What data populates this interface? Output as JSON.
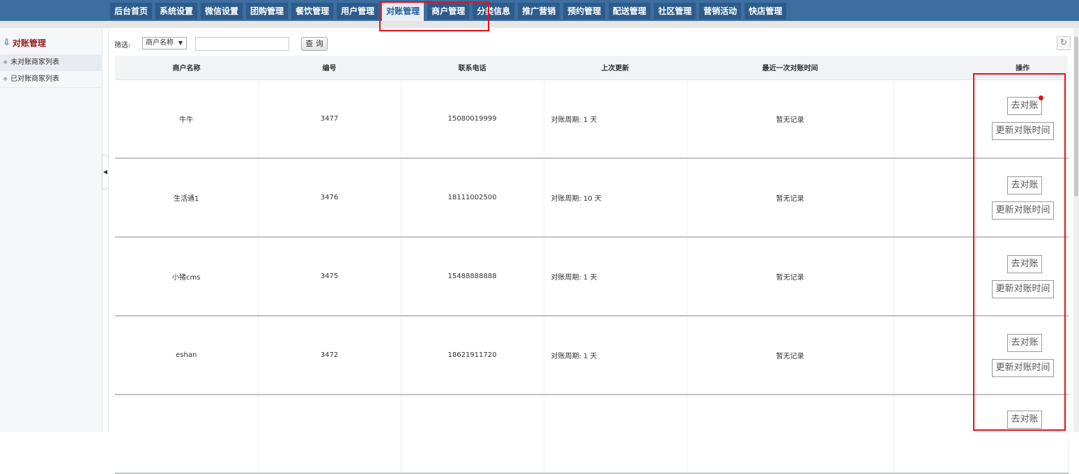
{
  "nav": {
    "tabs": [
      {
        "label": "后台首页",
        "active": false
      },
      {
        "label": "系统设置",
        "active": false
      },
      {
        "label": "微信设置",
        "active": false
      },
      {
        "label": "团购管理",
        "active": false
      },
      {
        "label": "餐饮管理",
        "active": false
      },
      {
        "label": "用户管理",
        "active": false
      },
      {
        "label": "对账管理",
        "active": true
      },
      {
        "label": "商户管理",
        "active": false
      },
      {
        "label": "分类信息",
        "active": false
      },
      {
        "label": "推广营销",
        "active": false
      },
      {
        "label": "预约管理",
        "active": false
      },
      {
        "label": "配送管理",
        "active": false
      },
      {
        "label": "社区管理",
        "active": false
      },
      {
        "label": "营销活动",
        "active": false
      },
      {
        "label": "快店管理",
        "active": false
      }
    ]
  },
  "sidebar": {
    "title": "对账管理",
    "items": [
      {
        "label": "未对账商家列表",
        "active": true
      },
      {
        "label": "已对账商家列表",
        "active": false
      }
    ]
  },
  "filter": {
    "label": "筛选:",
    "select_value": "商户名称",
    "input_value": "",
    "query_label": "查 询"
  },
  "table": {
    "headers": [
      "商户名称",
      "编号",
      "联系电话",
      "上次更新",
      "最近一次对账时间",
      "操作"
    ],
    "rows": [
      {
        "name": "牛牛",
        "id": "3477",
        "phone": "15080019999",
        "cycle": "对账周期: 1 天",
        "last": "暂无记录",
        "btn1": "去对账",
        "btn2": "更新对账时间"
      },
      {
        "name": "生活通1",
        "id": "3476",
        "phone": "18111002500",
        "cycle": "对账周期: 10 天",
        "last": "暂无记录",
        "btn1": "去对账",
        "btn2": "更新对账时间"
      },
      {
        "name": "小猪cms",
        "id": "3475",
        "phone": "15488888888",
        "cycle": "对账周期: 1 天",
        "last": "暂无记录",
        "btn1": "去对账",
        "btn2": "更新对账时间"
      },
      {
        "name": "eshan",
        "id": "3472",
        "phone": "18621911720",
        "cycle": "对账周期: 1 天",
        "last": "暂无记录",
        "btn1": "去对账",
        "btn2": "更新对账时间"
      },
      {
        "name": "",
        "id": "",
        "phone": "",
        "cycle": "",
        "last": "",
        "btn1": "去对账",
        "btn2": ""
      }
    ]
  },
  "colors": {
    "accent": "#3d6ea0",
    "highlight": "#e8101a"
  }
}
